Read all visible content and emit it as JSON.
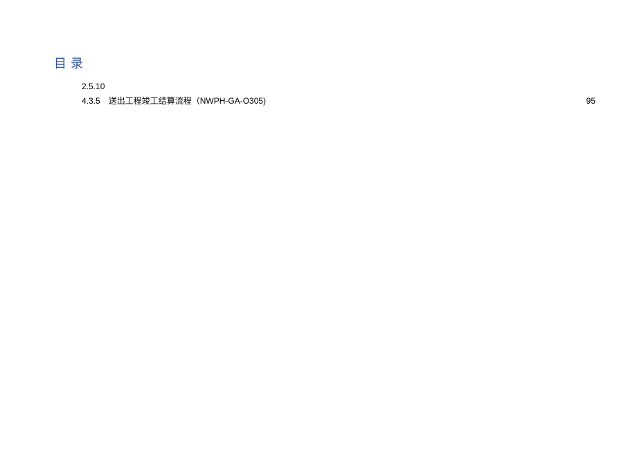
{
  "heading": "目录",
  "toc": {
    "rows": [
      {
        "number": "2.5.10",
        "title": "",
        "page": ""
      },
      {
        "number": "4.3.5",
        "title": "送出工程竣工结算流程（NWPH-GA-O305)",
        "page": "95"
      }
    ]
  }
}
